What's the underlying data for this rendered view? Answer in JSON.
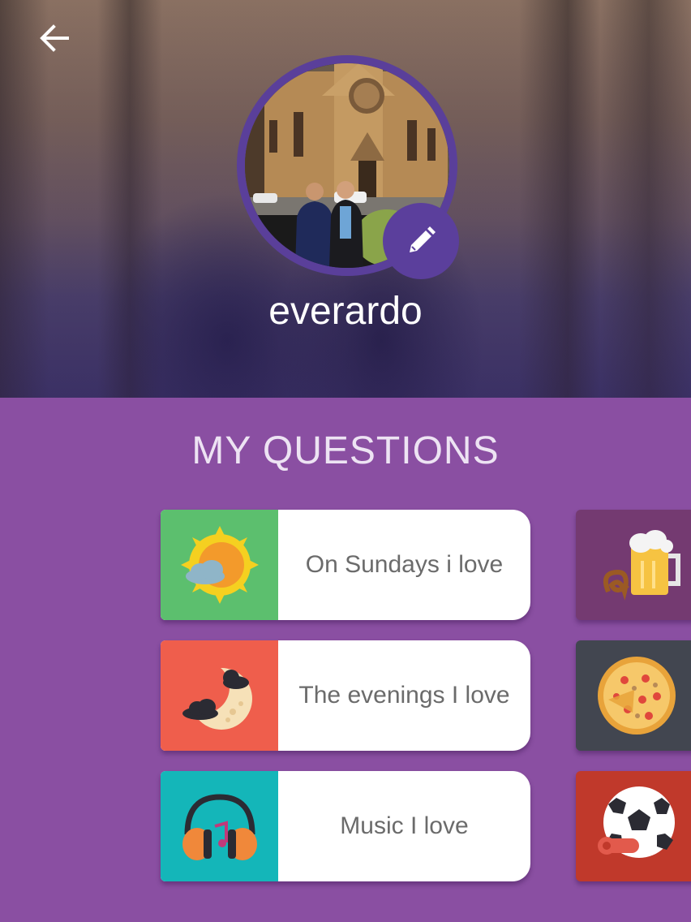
{
  "profile": {
    "username": "everardo"
  },
  "section": {
    "title": "MY QUESTIONS"
  },
  "questions": [
    {
      "label": "On Sundays i love",
      "icon": "sun-cloud-icon",
      "tile_color": "#5cbf6e"
    },
    {
      "label": "The evenings I love",
      "icon": "moon-clouds-icon",
      "tile_color": "#ef5e4c"
    },
    {
      "label": "Music I love",
      "icon": "headphones-icon",
      "tile_color": "#14b6b9"
    }
  ],
  "side_tiles": [
    {
      "icon": "beer-pretzel-icon",
      "tile_color": "#743a71"
    },
    {
      "icon": "pizza-icon",
      "tile_color": "#424650"
    },
    {
      "icon": "soccer-ball-whistle-icon",
      "tile_color": "#c0392b"
    }
  ],
  "colors": {
    "background": "#8a4fa2",
    "accent": "#5b3f9c"
  }
}
